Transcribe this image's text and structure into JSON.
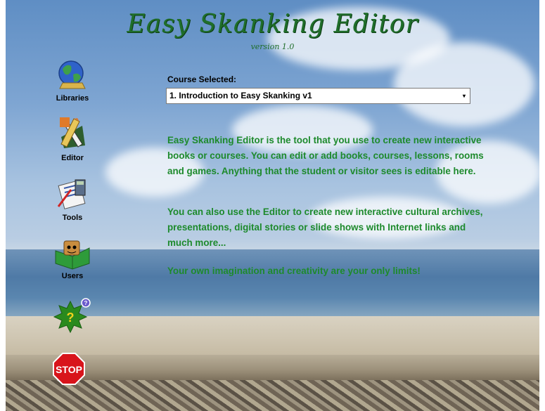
{
  "app": {
    "title": "Easy Skanking Editor",
    "version": "version 1.0"
  },
  "nav": {
    "libraries_label": "Libraries",
    "editor_label": "Editor",
    "tools_label": "Tools",
    "users_label": "Users",
    "help_glyph": "?",
    "help_badge": "?",
    "stop_label": "STOP"
  },
  "course": {
    "label": "Course Selected:",
    "selected": "1. Introduction to Easy Skanking v1"
  },
  "description": {
    "para1": "Easy Skanking Editor is the tool that you use to create new interactive books or courses. You can edit or add books, courses, lessons, rooms and games. Anything that the student or visitor sees is editable here.",
    "para2": "You can also use the Editor to create new interactive cultural archives, presentations, digital stories or slide shows with Internet links and much more...",
    "para3": "Your own imagination and creativity are your only limits!"
  },
  "colors": {
    "title_green": "#1f6e2a",
    "text_green": "#1d8a2c",
    "stop_red": "#d8141b",
    "help_green": "#2a8a1e"
  },
  "icons": [
    "globe-icon",
    "pencil-ruler-icon",
    "tools-icon",
    "users-book-icon",
    "help-icon",
    "stop-icon"
  ]
}
